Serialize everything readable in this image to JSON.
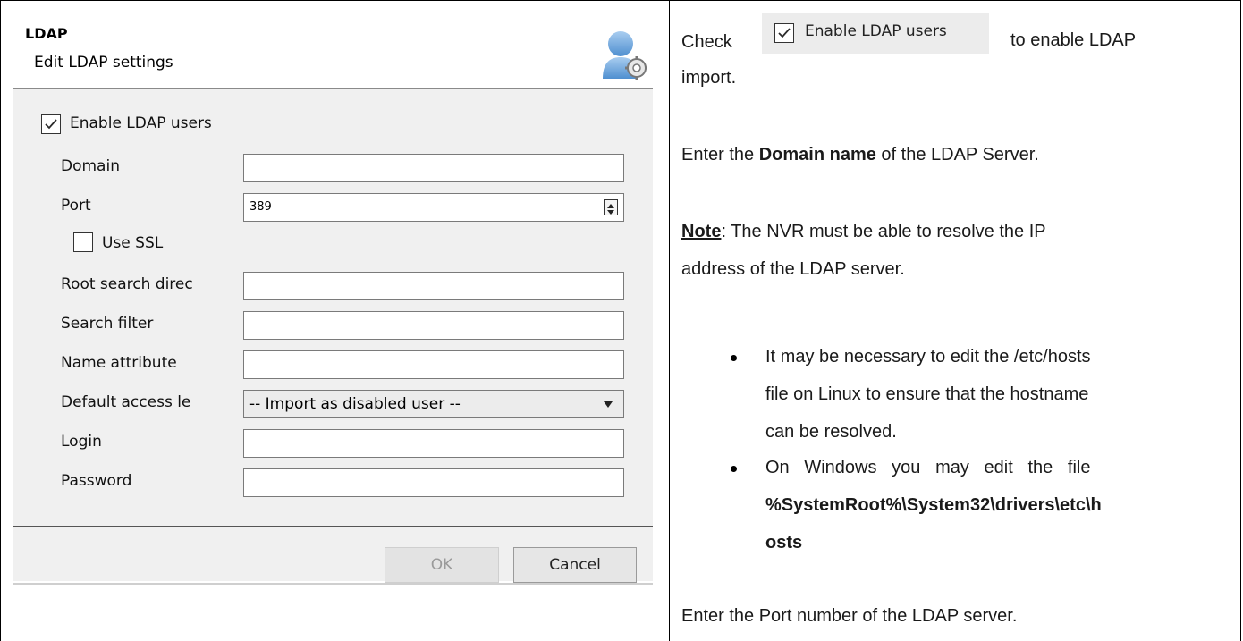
{
  "dialog": {
    "title": "LDAP",
    "subtitle": "Edit LDAP settings",
    "enable_label": "Enable LDAP users",
    "enable_checked": true,
    "fields": {
      "domain_label": "Domain",
      "domain_value": "",
      "port_label": "Port",
      "port_value": "389",
      "use_ssl_label": "Use SSL",
      "use_ssl_checked": false,
      "root_label": "Root search direc",
      "root_value": "",
      "filter_label": "Search filter",
      "filter_value": "",
      "name_attr_label": "Name attribute",
      "name_attr_value": "",
      "access_label": "Default access le",
      "access_value": "-- Import as disabled user --",
      "login_label": "Login",
      "login_value": "",
      "password_label": "Password",
      "password_value": ""
    },
    "ok_label": "OK",
    "cancel_label": "Cancel",
    "icon": "user-settings-icon"
  },
  "doc": {
    "check_word": "Check",
    "inline_checkbox_label": "Enable LDAP users",
    "check_tail": "to enable LDAP",
    "check_tail2": "import.",
    "domain_pre": "Enter the ",
    "domain_bold": "Domain name",
    "domain_post": " of the LDAP Server.",
    "note_word": "Note",
    "note_text1": ": The NVR must be able to resolve the IP",
    "note_text2": "address of the LDAP server.",
    "bullet1_l1": "It may be necessary to edit the /etc/hosts",
    "bullet1_l2": "file on Linux to ensure that the hostname",
    "bullet1_l3": "can be resolved.",
    "bullet2_l1": "On   Windows   you   may   edit   the   file",
    "bullet2_l2": "%SystemRoot%\\System32\\drivers\\etc\\h",
    "bullet2_l3": "osts",
    "port_text": "Enter the Port number of the LDAP server."
  }
}
